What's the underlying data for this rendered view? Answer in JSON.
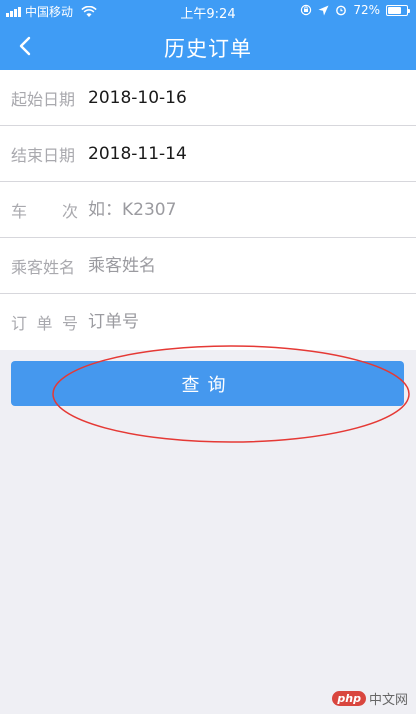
{
  "status_bar": {
    "carrier": "中国移动",
    "time": "上午9:24",
    "battery": "72%",
    "battery_level": 0.72
  },
  "header": {
    "title": "历史订单",
    "back_icon": "chevron-left-icon"
  },
  "form": {
    "start_date": {
      "label": "起始日期",
      "value": "2018-10-16"
    },
    "end_date": {
      "label": "结束日期",
      "value": "2018-11-14"
    },
    "train_no": {
      "label_chars": [
        "车",
        "次"
      ],
      "placeholder": "如：K2307"
    },
    "passenger": {
      "label": "乘客姓名",
      "placeholder": "乘客姓名"
    },
    "order_no": {
      "label_chars": [
        "订",
        "单",
        "号"
      ],
      "placeholder": "订单号"
    }
  },
  "query_button": {
    "label": "查询"
  },
  "watermark": {
    "logo": "php",
    "text": "中文网"
  },
  "colors": {
    "primary": "#3f9cf5",
    "button": "#4598ee",
    "annotation": "#e53935"
  }
}
